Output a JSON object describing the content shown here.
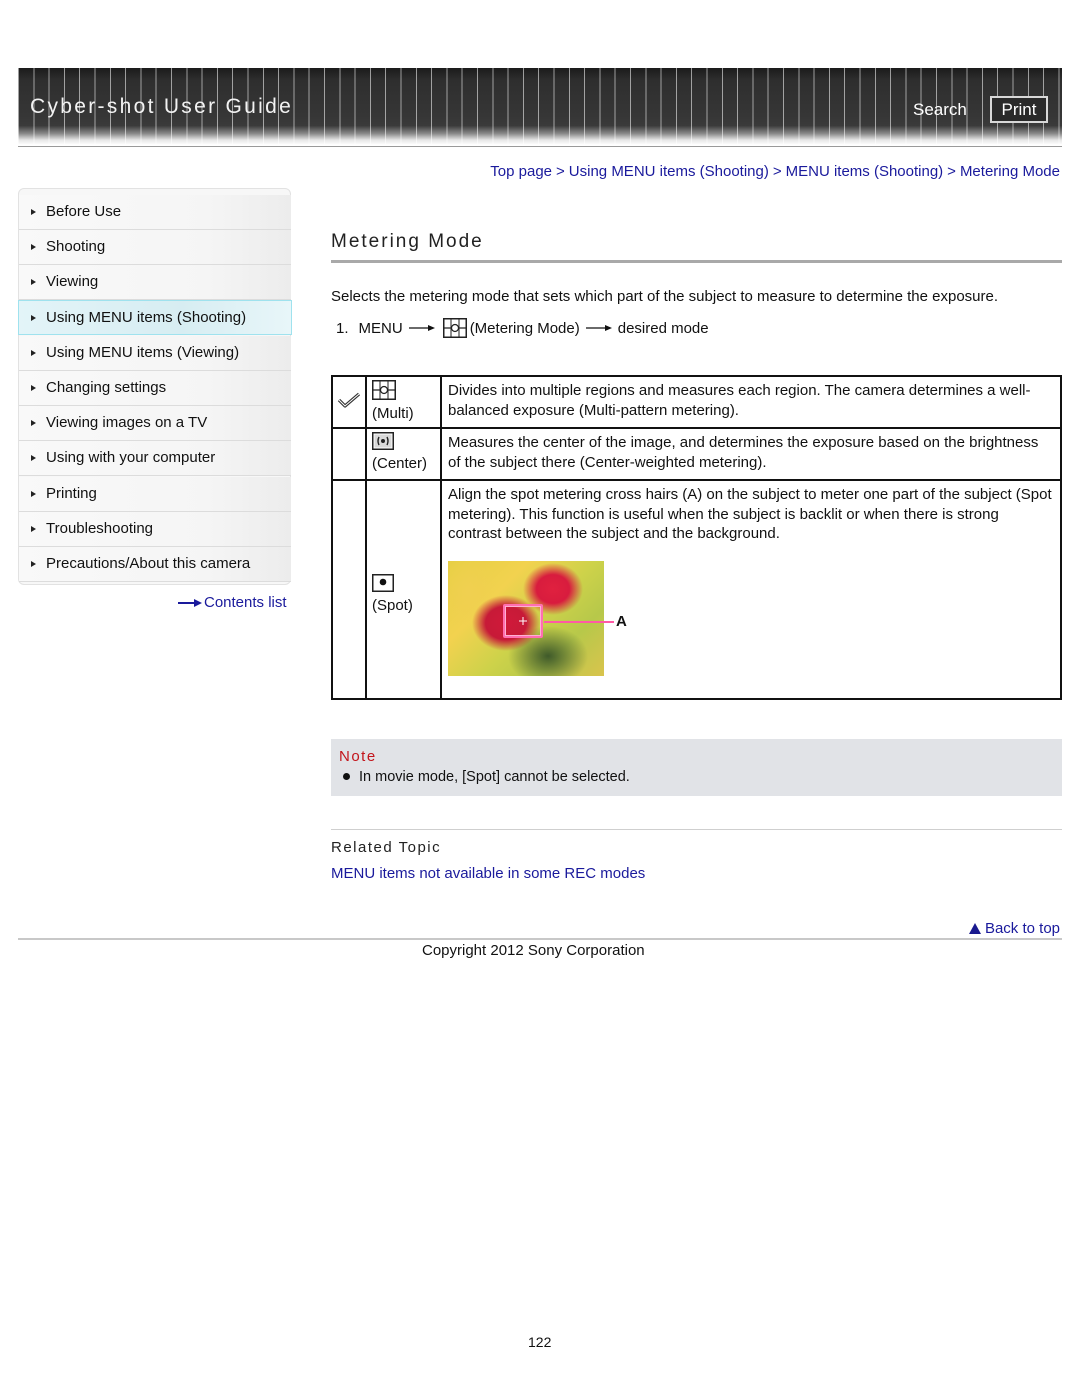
{
  "header": {
    "app_title": "Cyber-shot User Guide",
    "search_label": "Search",
    "print_label": "Print"
  },
  "breadcrumb": [
    {
      "label": "Top page"
    },
    {
      "label": "Using MENU items (Shooting)"
    },
    {
      "label": "MENU items (Shooting)"
    },
    {
      "label": "Metering Mode"
    }
  ],
  "breadcrumb_separator": ">",
  "sidebar": {
    "items": [
      {
        "label": "Before Use",
        "active": false
      },
      {
        "label": "Shooting",
        "active": false
      },
      {
        "label": "Viewing",
        "active": false
      },
      {
        "label": "Using MENU items (Shooting)",
        "active": true
      },
      {
        "label": "Using MENU items (Viewing)",
        "active": false
      },
      {
        "label": "Changing settings",
        "active": false
      },
      {
        "label": "Viewing images on a TV",
        "active": false
      },
      {
        "label": "Using with your computer",
        "active": false
      },
      {
        "label": "Printing",
        "active": false
      },
      {
        "label": "Troubleshooting",
        "active": false
      },
      {
        "label": "Precautions/About this camera",
        "active": false
      }
    ],
    "contents_list_label": "Contents list"
  },
  "main": {
    "title": "Metering Mode",
    "intro": "Selects the metering mode that sets which part of the subject to measure to determine the exposure.",
    "step": {
      "number": "1.",
      "menu": "MENU",
      "icon": "metering-mode-multi-icon",
      "item": "(Metering Mode)",
      "target": "desired mode"
    },
    "modes": [
      {
        "default": true,
        "icon": "multi-metering-icon",
        "name": "(Multi)",
        "description": "Divides into multiple regions and measures each region. The camera determines a well-balanced exposure (Multi-pattern metering)."
      },
      {
        "default": false,
        "icon": "center-metering-icon",
        "name": "(Center)",
        "description": "Measures the center of the image, and determines the exposure based on the brightness of the subject there (Center-weighted metering)."
      },
      {
        "default": false,
        "icon": "spot-metering-icon",
        "name": "(Spot)",
        "description": "Align the spot metering cross hairs (A) on the subject to meter one part of the subject (Spot metering). This function is useful when the subject is backlit or when there is strong contrast between the subject and the background.",
        "image_callout": "A"
      }
    ],
    "note": {
      "title": "Note",
      "items": [
        "In movie mode, [Spot] cannot be selected."
      ]
    },
    "related": {
      "title": "Related Topic",
      "links": [
        "MENU items not available in some REC modes"
      ]
    }
  },
  "footer": {
    "back_to_top": "Back to top",
    "copyright": "Copyright 2012 Sony Corporation",
    "page_number": "122"
  },
  "colors": {
    "link": "#1a1a9c",
    "note_title": "#c3141b",
    "note_bg": "#e1e3e7",
    "active_nav_border": "#9fe2ee"
  }
}
